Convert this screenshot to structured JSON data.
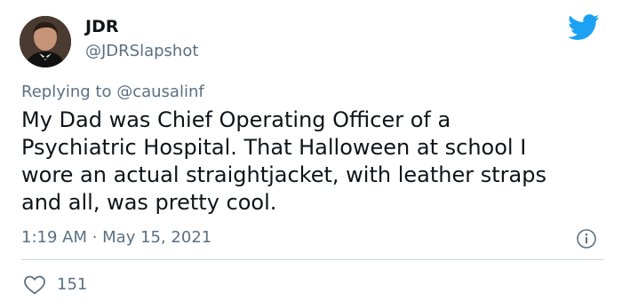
{
  "user": {
    "display_name": "JDR",
    "handle": "@JDRSlapshot"
  },
  "reply": {
    "prefix": "Replying to ",
    "mention": "@causalinf"
  },
  "tweet": {
    "text": "My Dad was Chief Operating Officer of a\nPsychiatric Hospital.  That Halloween at school I\nwore an actual straightjacket, with leather straps\nand all, was pretty cool.",
    "timestamp": "1:19 AM · May 15, 2021"
  },
  "engagement": {
    "likes": "151"
  },
  "icons": {
    "brand": "twitter-bird-icon",
    "info": "info-icon",
    "like": "heart-icon"
  },
  "colors": {
    "brand_blue": "#1DA1F2",
    "secondary_text": "#5B7083",
    "primary_text": "#0F1419"
  }
}
